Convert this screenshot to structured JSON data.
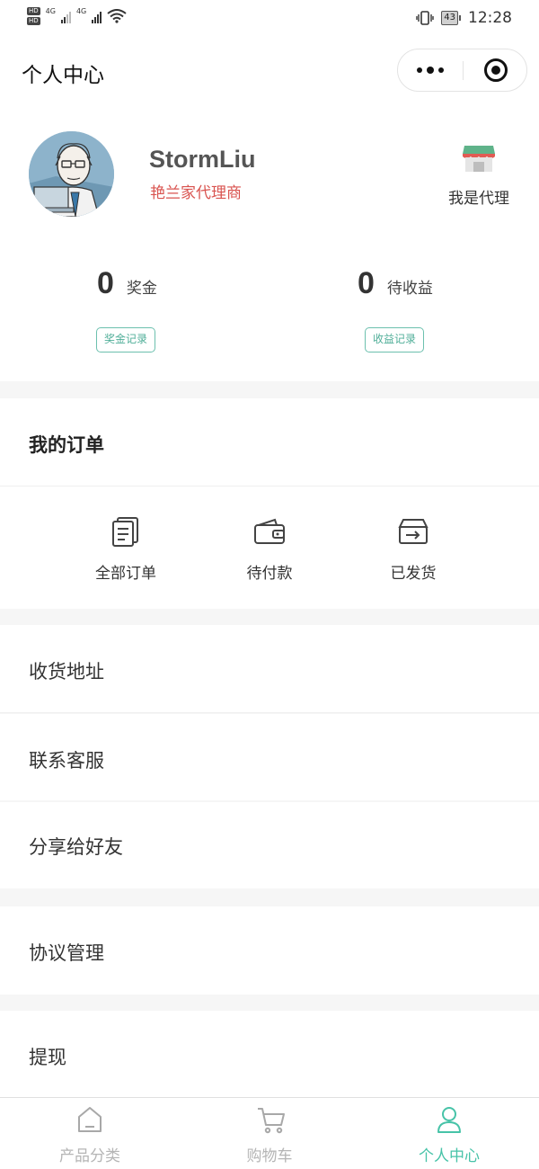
{
  "status_bar": {
    "hd_label": "HD",
    "network_1": "4G",
    "network_2": "4G",
    "battery": "43",
    "time": "12:28"
  },
  "nav": {
    "title": "个人中心"
  },
  "profile": {
    "username": "StormLiu",
    "role": "艳兰家代理商",
    "agent_label": "我是代理",
    "bonus_value": "0",
    "bonus_label": "奖金",
    "pending_value": "0",
    "pending_label": "待收益",
    "bonus_record_label": "奖金记录",
    "income_record_label": "收益记录"
  },
  "orders": {
    "title": "我的订单",
    "items": [
      {
        "label": "全部订单",
        "icon": "order-list-icon"
      },
      {
        "label": "待付款",
        "icon": "wallet-icon"
      },
      {
        "label": "已发货",
        "icon": "shipped-box-icon"
      }
    ]
  },
  "menu": {
    "address": "收货地址",
    "service": "联系客服",
    "share": "分享给好友",
    "agreement": "协议管理",
    "withdraw": "提现"
  },
  "tabbar": {
    "items": [
      {
        "label": "产品分类",
        "icon": "home-icon",
        "active": false
      },
      {
        "label": "购物车",
        "icon": "cart-icon",
        "active": false
      },
      {
        "label": "个人中心",
        "icon": "user-icon",
        "active": true
      }
    ]
  },
  "colors": {
    "accent": "#47c3a8",
    "role_red": "#d9534f",
    "inactive_tab": "#b5b5b5"
  }
}
